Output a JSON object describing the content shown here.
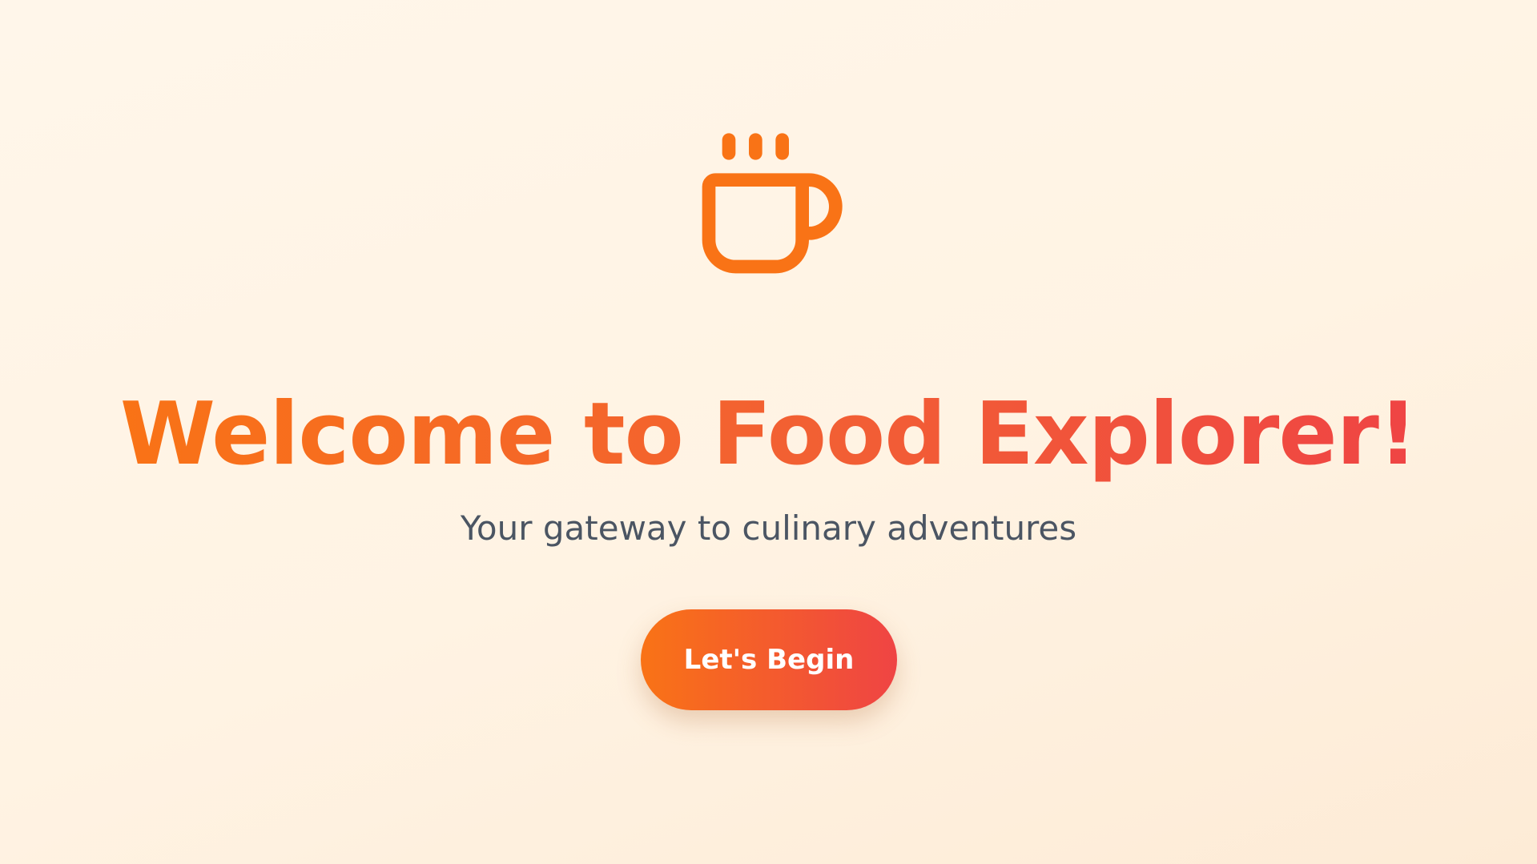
{
  "hero": {
    "icon": "coffee-cup-icon",
    "title": "Welcome to Food Explorer!",
    "subtitle": "Your gateway to culinary adventures",
    "button_label": "Let's Begin"
  },
  "colors": {
    "background": "#fff4e6",
    "accent_orange": "#f97316",
    "accent_red": "#ef4444",
    "subtitle_text": "#4b5563",
    "button_text": "#ffffff"
  }
}
